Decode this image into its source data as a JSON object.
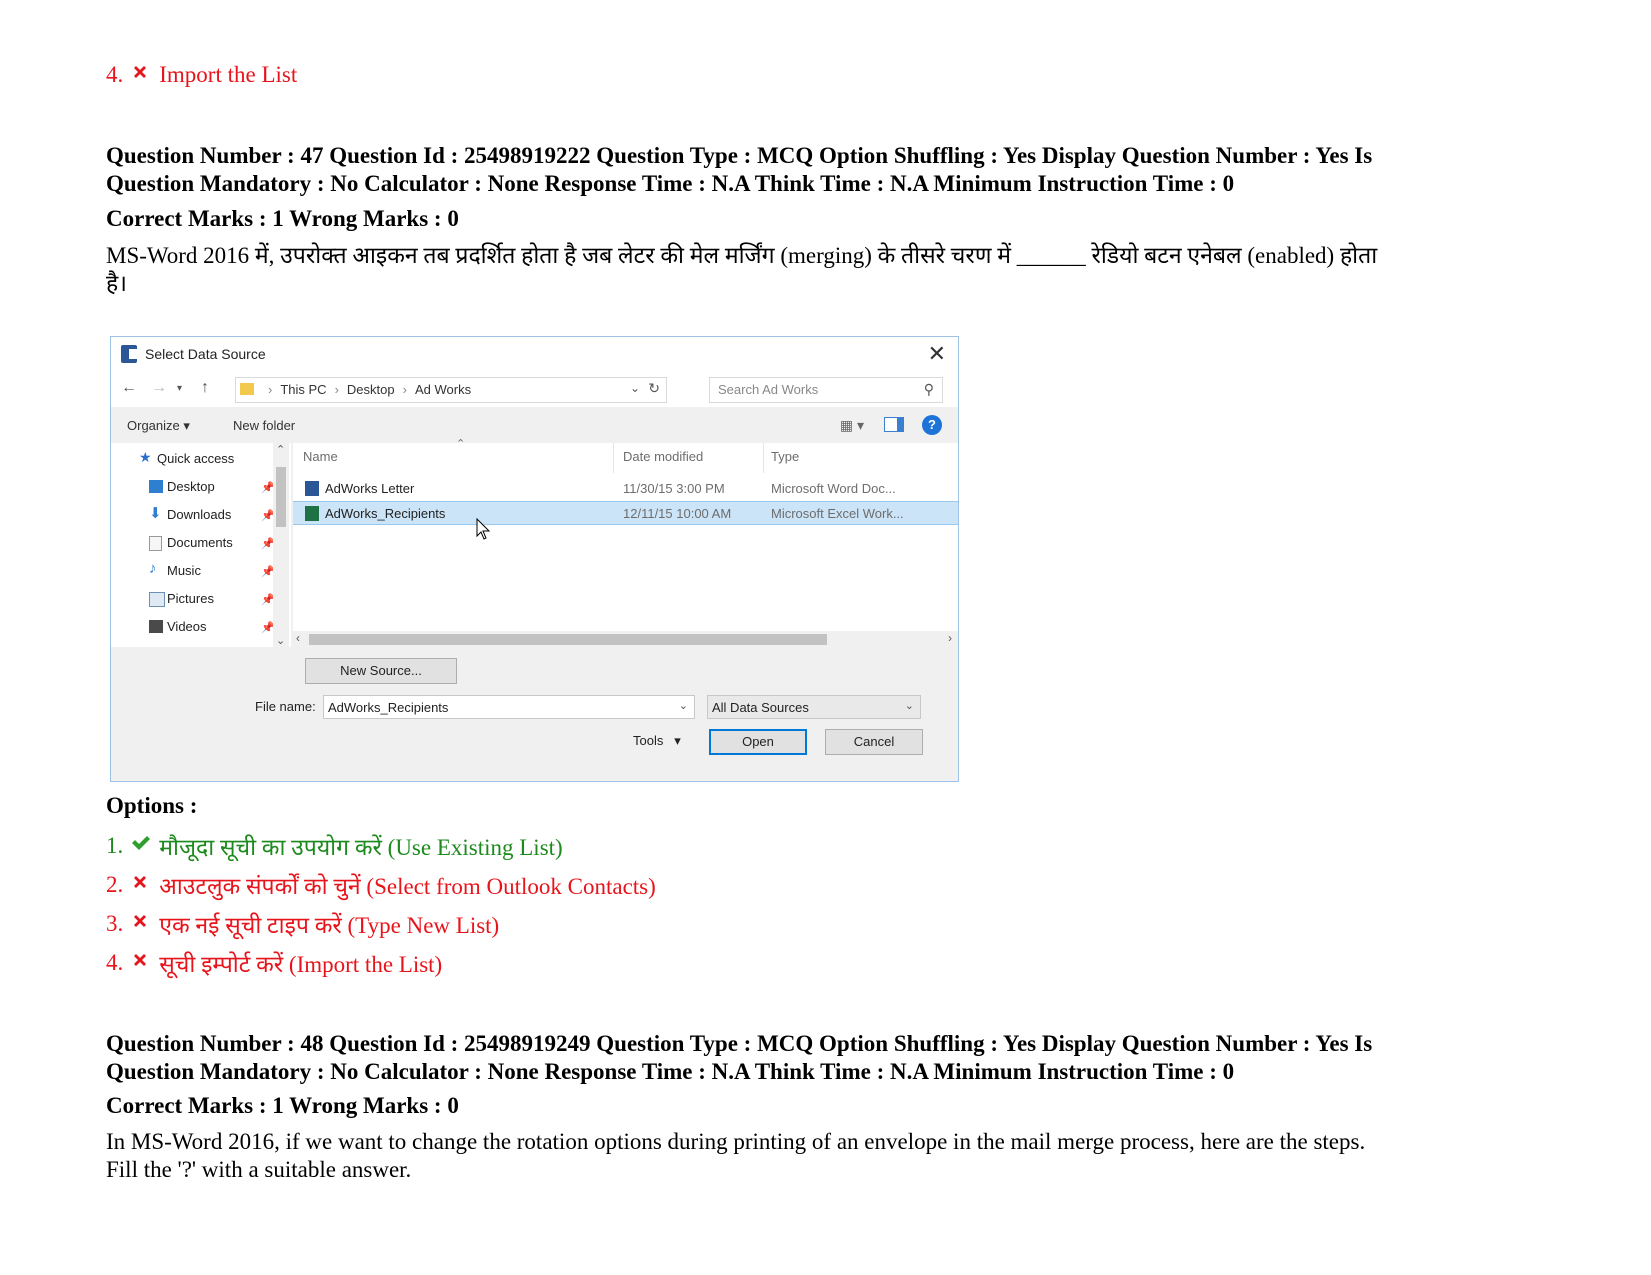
{
  "prev_option": {
    "num": "4.",
    "text": "Import the List"
  },
  "q47": {
    "meta_line1": "Question Number : 47 Question Id : 25498919222 Question Type : MCQ Option Shuffling : Yes Display Question Number : Yes Is",
    "meta_line2": "Question Mandatory : No Calculator : None Response Time : N.A Think Time : N.A Minimum Instruction Time : 0",
    "marks": "Correct Marks : 1 Wrong Marks : 0",
    "text_line1": "MS-Word 2016 में, उपरोक्त आइकन तब प्रदर्शित होता है जब लेटर की मेल मर्जिंग (merging) के तीसरे चरण में ______ रेडियो बटन एनेबल (enabled) होता",
    "text_line2": "है।",
    "options_label": "Options :",
    "options": [
      {
        "num": "1.",
        "text": "मौजूदा सूची का उपयोग करें (Use Existing List)",
        "correct": true
      },
      {
        "num": "2.",
        "text": "आउटलुक संपर्कों को चुनें (Select from Outlook Contacts)",
        "correct": false
      },
      {
        "num": "3.",
        "text": "एक नई सूची टाइप करें (Type New List)",
        "correct": false
      },
      {
        "num": "4.",
        "text": "सूची इम्पोर्ट करें (Import the List)",
        "correct": false
      }
    ]
  },
  "dialog": {
    "title": "Select Data Source",
    "breadcrumbs": [
      "This PC",
      "Desktop",
      "Ad Works"
    ],
    "search_placeholder": "Search Ad Works",
    "organize": "Organize ▾",
    "new_folder": "New folder",
    "nav_items": [
      "Quick access",
      "Desktop",
      "Downloads",
      "Documents",
      "Music",
      "Pictures",
      "Videos"
    ],
    "columns": [
      "Name",
      "Date modified",
      "Type"
    ],
    "files": [
      {
        "name": "AdWorks Letter",
        "date": "11/30/15 3:00 PM",
        "type": "Microsoft Word Doc..."
      },
      {
        "name": "AdWorks_Recipients",
        "date": "12/11/15 10:00 AM",
        "type": "Microsoft Excel Work..."
      }
    ],
    "new_source": "New Source...",
    "file_name_label": "File name:",
    "file_name_value": "AdWorks_Recipients",
    "filter_value": "All Data Sources",
    "tools": "Tools",
    "open": "Open",
    "cancel": "Cancel"
  },
  "q48": {
    "meta_line1": "Question Number : 48 Question Id : 25498919249 Question Type : MCQ Option Shuffling : Yes Display Question Number : Yes Is",
    "meta_line2": "Question Mandatory : No Calculator : None Response Time : N.A Think Time : N.A Minimum Instruction Time : 0",
    "marks": "Correct Marks : 1 Wrong Marks : 0",
    "text_line1": "In MS-Word 2016, if we want to change the rotation options during printing of an envelope in the mail merge process, here are the steps.",
    "text_line2": "Fill the '?' with a suitable answer."
  },
  "colors": {
    "correct": "#1c8a1c",
    "wrong": "#e8141b"
  }
}
